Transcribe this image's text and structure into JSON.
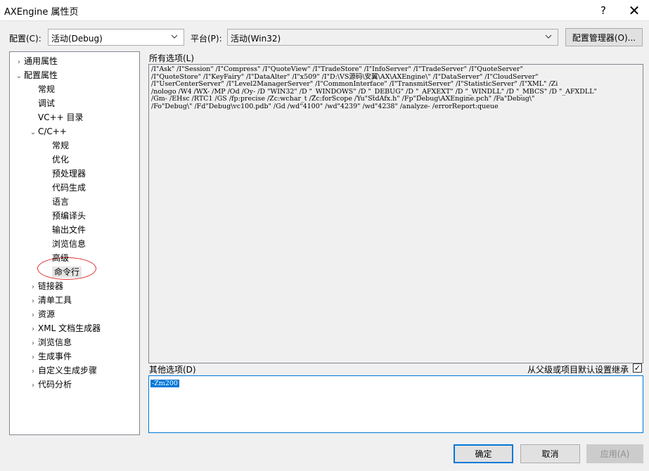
{
  "window": {
    "title": "AXEngine 属性页",
    "help_glyph": "?",
    "close_glyph": "✕"
  },
  "config": {
    "label": "配置(C):",
    "value": "活动(Debug)"
  },
  "platform": {
    "label": "平台(P):",
    "value": "活动(Win32)"
  },
  "config_manager_button": "配置管理器(O)...",
  "tree": [
    {
      "label": "通用属性",
      "arrow": "›"
    },
    {
      "label": "配置属性",
      "arrow": "⌄"
    },
    {
      "label": "常规",
      "arrow": ""
    },
    {
      "label": "调试",
      "arrow": ""
    },
    {
      "label": "VC++ 目录",
      "arrow": ""
    },
    {
      "label": "C/C++",
      "arrow": "⌄"
    },
    {
      "label": "常规",
      "arrow": ""
    },
    {
      "label": "优化",
      "arrow": ""
    },
    {
      "label": "预处理器",
      "arrow": ""
    },
    {
      "label": "代码生成",
      "arrow": ""
    },
    {
      "label": "语言",
      "arrow": ""
    },
    {
      "label": "预编译头",
      "arrow": ""
    },
    {
      "label": "输出文件",
      "arrow": ""
    },
    {
      "label": "浏览信息",
      "arrow": ""
    },
    {
      "label": "高级",
      "arrow": ""
    },
    {
      "label": "命令行",
      "arrow": ""
    },
    {
      "label": "链接器",
      "arrow": "›"
    },
    {
      "label": "清单工具",
      "arrow": "›"
    },
    {
      "label": "资源",
      "arrow": "›"
    },
    {
      "label": "XML 文档生成器",
      "arrow": "›"
    },
    {
      "label": "浏览信息",
      "arrow": "›"
    },
    {
      "label": "生成事件",
      "arrow": "›"
    },
    {
      "label": "自定义生成步骤",
      "arrow": "›"
    },
    {
      "label": "代码分析",
      "arrow": "›"
    }
  ],
  "all_options": {
    "label": "所有选项(L)",
    "text": "/I\"Ask\" /I\"Session\" /I\"Compress\" /I\"QuoteView\" /I\"TradeStore\" /I\"InfoServer\" /I\"TradeServer\" /I\"QuoteServer\"\n/I\"QuoteStore\" /I\"KeyFairy\" /I\"DataAlter\" /I\"x509\" /I\"D:\\VS源码\\安翼\\AX\\AXEngine\\\" /I\"DataServer\" /I\"CloudServer\"\n/I\"UserCenterServer\" /I\"Level2ManagerServer\" /I\"CommonInterface\" /I\"TransmitServer\" /I\"StatisticServer\" /I\"XML\" /Zi\n/nologo /W4 /WX- /MP /Od /Oy- /D \"WIN32\" /D \"_WINDOWS\" /D \"_DEBUG\" /D \"_AFXEXT\" /D \"_WINDLL\" /D \"_MBCS\" /D \"_AFXDLL\"\n/Gm- /EHsc /RTC1 /GS /fp:precise /Zc:wchar_t /Zc:forScope /Yu\"StdAfx.h\" /Fp\"Debug\\AXEngine.pch\" /Fa\"Debug\\\"\n/Fo\"Debug\\\" /Fd\"Debug\\vc100.pdb\" /Gd /wd\"4100\" /wd\"4239\" /wd\"4238\" /analyze- /errorReport:queue"
  },
  "other_options": {
    "label": "其他选项(D)",
    "value": "-Zm200"
  },
  "inherit": {
    "label": "从父级或项目默认设置继承",
    "checked_glyph": "✓"
  },
  "buttons": {
    "ok": "确定",
    "cancel": "取消",
    "apply": "应用(A)"
  }
}
